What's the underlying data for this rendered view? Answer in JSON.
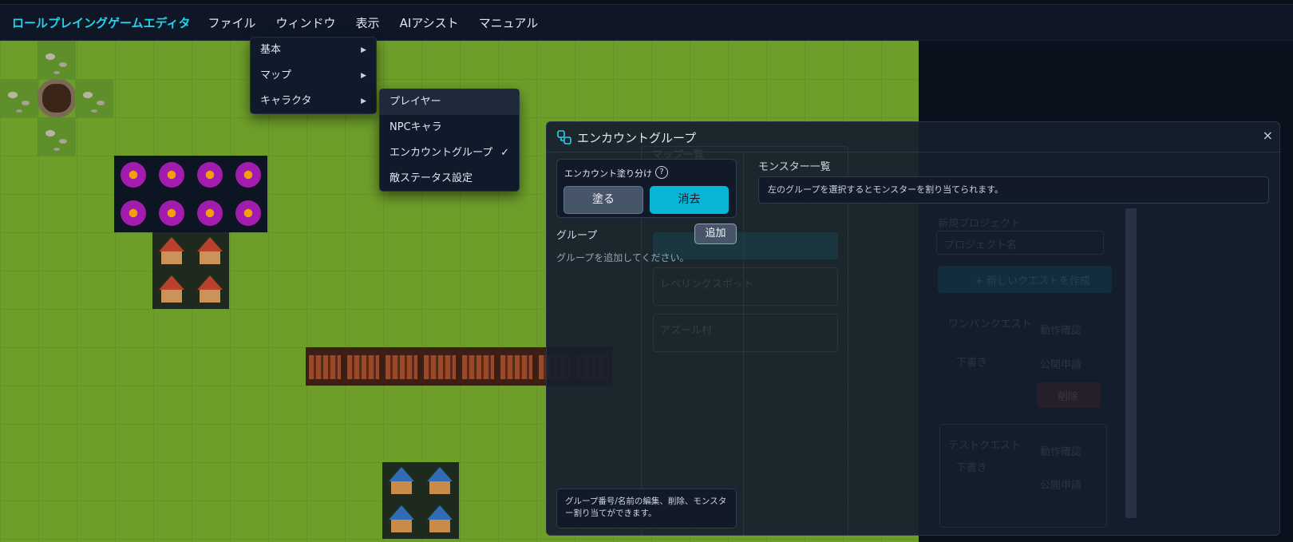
{
  "menubar": {
    "brand": "ロールプレイングゲームエディタ",
    "items": [
      "ファイル",
      "ウィンドウ",
      "表示",
      "AIアシスト",
      "マニュアル"
    ]
  },
  "window_menu": {
    "items": [
      {
        "label": "基本",
        "arrow": "▶"
      },
      {
        "label": "マップ",
        "arrow": "▶"
      },
      {
        "label": "キャラクタ",
        "arrow": "▶"
      }
    ]
  },
  "character_submenu": {
    "items": [
      {
        "label": "プレイヤー",
        "check": ""
      },
      {
        "label": "NPCキャラ",
        "check": ""
      },
      {
        "label": "エンカウントグループ",
        "check": "✓"
      },
      {
        "label": "敵ステータス設定",
        "check": ""
      }
    ]
  },
  "encounter_panel": {
    "title": "エンカウントグループ",
    "close": "×",
    "paint_label": "エンカウント塗り分け",
    "help": "?",
    "paint_button": "塗る",
    "erase_button": "消去",
    "group_label": "グループ",
    "add_button": "追加",
    "group_empty": "グループを追加してください。",
    "hint": "グループ番号/名前の編集、削除、モンスター割り当てができます。",
    "monster_label": "モンスター一覧",
    "monster_hint": "左のグループを選択するとモンスターを割り当てられます。"
  },
  "background_ghost": {
    "map_list": "マップ一覧",
    "spot1": "レベリングスポット",
    "spot2": "アズール村",
    "project_label": "新規プロジェクト",
    "project_placeholder": "プロジェクト名",
    "new_button": "+ 新しいクエストを作成",
    "quest1": "ワンパンクエスト",
    "quest2": "テストクエスト",
    "draft": "下書き",
    "edit": "動作確認",
    "publish": "公開申請",
    "delete": "削除"
  },
  "colors": {
    "accent": "#22d3ee",
    "grass": "#6e9e2a",
    "panel_bg": "#161e2d",
    "erase_button": "#06b6d4"
  }
}
